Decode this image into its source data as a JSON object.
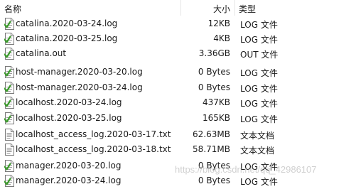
{
  "columns": {
    "name": "名称",
    "size": "大小",
    "type": "类型"
  },
  "files": [
    {
      "name": "catalina.2020-03-24.log",
      "size": "12KB",
      "type": "LOG 文件",
      "icon": "log-file-icon"
    },
    {
      "name": "catalina.2020-03-25.log",
      "size": "4KB",
      "type": "LOG 文件",
      "icon": "log-file-icon"
    },
    {
      "name": "catalina.out",
      "size": "3.36GB",
      "type": "OUT 文件",
      "icon": "log-file-icon"
    },
    {
      "name": "host-manager.2020-03-20.log",
      "size": "0 Bytes",
      "type": "LOG 文件",
      "icon": "log-file-icon"
    },
    {
      "name": "host-manager.2020-03-24.log",
      "size": "0 Bytes",
      "type": "LOG 文件",
      "icon": "log-file-icon"
    },
    {
      "name": "localhost.2020-03-24.log",
      "size": "437KB",
      "type": "LOG 文件",
      "icon": "log-file-icon"
    },
    {
      "name": "localhost.2020-03-25.log",
      "size": "165KB",
      "type": "LOG 文件",
      "icon": "log-file-icon"
    },
    {
      "name": "localhost_access_log.2020-03-17.txt",
      "size": "62.63MB",
      "type": "文本文档",
      "icon": "text-document-icon"
    },
    {
      "name": "localhost_access_log.2020-03-18.txt",
      "size": "58.71MB",
      "type": "文本文档",
      "icon": "text-document-icon"
    },
    {
      "name": "manager.2020-03-20.log",
      "size": "0 Bytes",
      "type": "LOG 文件",
      "icon": "log-file-icon"
    },
    {
      "name": "manager.2020-03-24.log",
      "size": "0 Bytes",
      "type": "LOG 文件",
      "icon": "log-file-icon"
    }
  ],
  "watermark": "https://blog.csdn.net/qq_42986107",
  "colors": {
    "header_separator": "#e5e5e5",
    "log_icon_green": "#3a9a2a",
    "text": "#1a1a1a"
  }
}
